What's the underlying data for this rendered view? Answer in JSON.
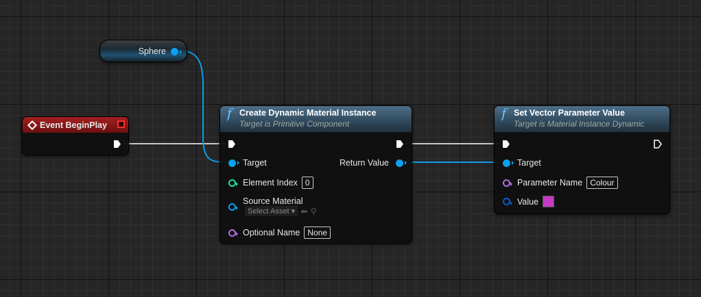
{
  "sphere_node": {
    "label": "Sphere"
  },
  "event_node": {
    "title": "Event BeginPlay"
  },
  "create_node": {
    "title": "Create Dynamic Material Instance",
    "subtitle": "Target is Primitive Component",
    "pins": {
      "target": "Target",
      "return_value": "Return Value",
      "element_index": "Element Index",
      "element_index_value": "0",
      "source_material": "Source Material",
      "select_asset": "Select Asset",
      "optional_name": "Optional Name",
      "optional_name_value": "None"
    }
  },
  "set_node": {
    "title": "Set Vector Parameter Value",
    "subtitle": "Target is Material Instance Dynamic",
    "pins": {
      "target": "Target",
      "parameter_name": "Parameter Name",
      "parameter_name_value": "Colour",
      "value": "Value"
    },
    "value_color": "#c43ac4"
  },
  "colors": {
    "object_pin": "#0aa0ef",
    "int_pin": "#1fe0a0",
    "name_pin": "#b06ee0",
    "struct_pin": "#0a5cc8",
    "event_header": "#8a1414"
  }
}
